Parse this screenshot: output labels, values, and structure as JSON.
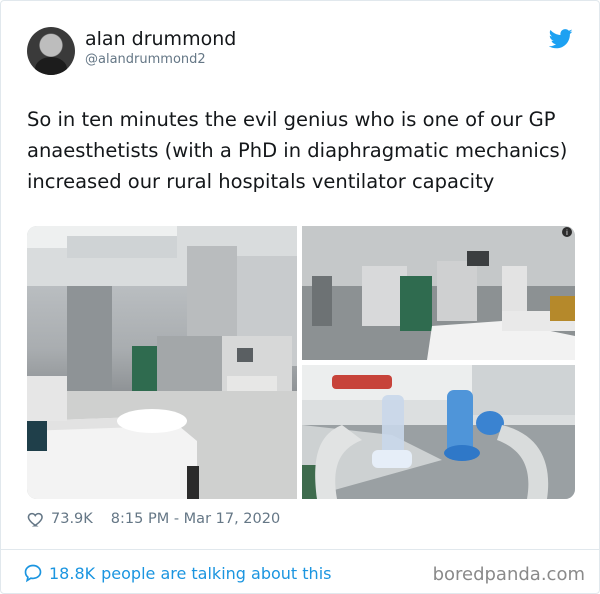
{
  "author": {
    "name": "alan drummond",
    "handle": "@alandrummond2"
  },
  "icons": {
    "logo": "twitter-bird-icon",
    "like": "heart-icon",
    "reply": "speech-bubble-icon"
  },
  "colors": {
    "twitter_blue": "#1da1f2",
    "link_blue": "#1b95e0",
    "meta_gray": "#657786"
  },
  "tweet": {
    "text": "So in ten minutes the evil genius who is one of our GP anaesthetists (with a PhD in diaphragmatic mechanics) increased our rural hospitals ventilator capacity",
    "likes": "73.9K",
    "time": "8:15 PM - Mar 17, 2020"
  },
  "footer": {
    "talking_count": "18.8K",
    "talking_text": "people are talking about this",
    "watermark": "boredpanda.com"
  }
}
